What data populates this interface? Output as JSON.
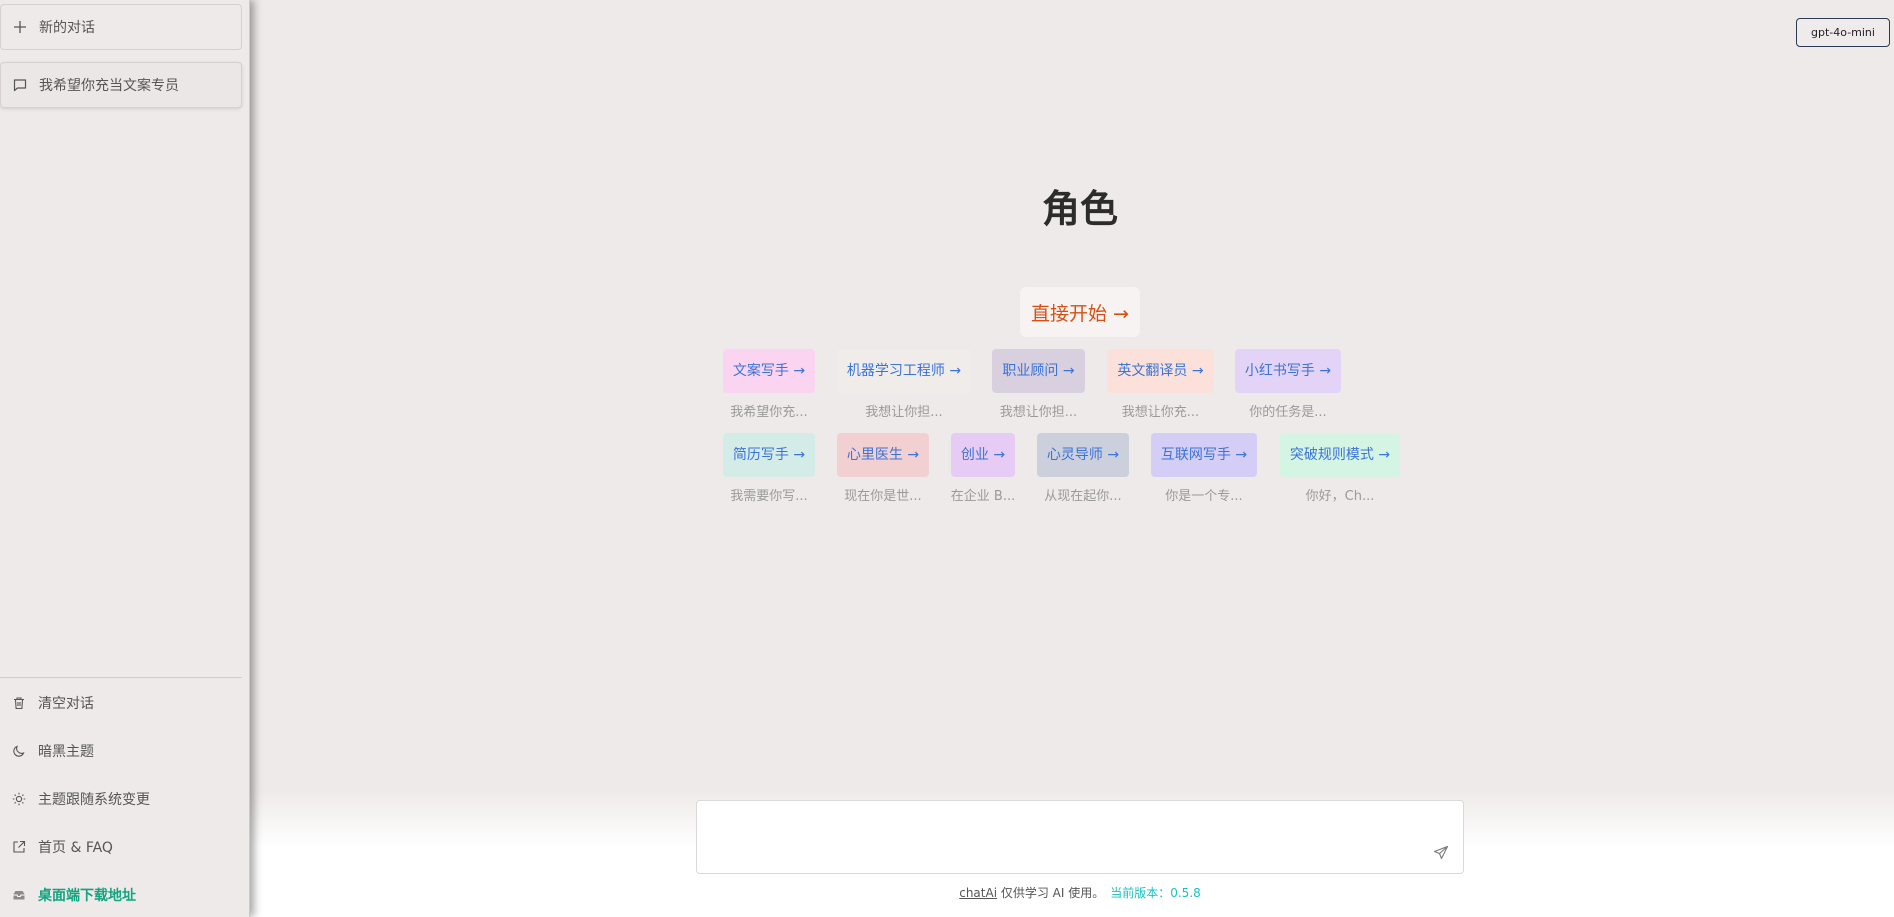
{
  "sidebar": {
    "new_chat": "新的对话",
    "conversation": "我希望你充当文案专员",
    "bottom": [
      {
        "label": "清空对话",
        "icon": "trash-icon"
      },
      {
        "label": "暗黑主题",
        "icon": "moon-icon"
      },
      {
        "label": "主题跟随系统变更",
        "icon": "sun-icon"
      },
      {
        "label": "首页 & FAQ",
        "icon": "external-link-icon"
      },
      {
        "label": "桌面端下载地址",
        "icon": "inbox-icon"
      }
    ]
  },
  "header": {
    "model": "gpt-4o-mini"
  },
  "main": {
    "title": "角色",
    "start": "直接开始 →",
    "roles": [
      {
        "label": "文案写手 →",
        "desc": "我希望你充..."
      },
      {
        "label": "机器学习工程师 →",
        "desc": "我想让你担..."
      },
      {
        "label": "职业顾问 →",
        "desc": "我想让你担..."
      },
      {
        "label": "英文翻译员 →",
        "desc": "我想让你充..."
      },
      {
        "label": "小红书写手 →",
        "desc": "你的任务是..."
      },
      {
        "label": "简历写手 →",
        "desc": "我需要你写..."
      },
      {
        "label": "心里医生 →",
        "desc": "现在你是世..."
      },
      {
        "label": "创业 →",
        "desc": "在企业 B..."
      },
      {
        "label": "心灵导师 →",
        "desc": "从现在起你..."
      },
      {
        "label": "互联网写手 →",
        "desc": "你是一个专..."
      },
      {
        "label": "突破规则模式 →",
        "desc": "你好，Ch..."
      }
    ]
  },
  "colors": {
    "role_bg": [
      "#fad4f0",
      "#f0ecea",
      "#d8d0df",
      "#fbe1d9",
      "#e3d4f7",
      "#d3ece8",
      "#f2d0d2",
      "#e6ccf4",
      "#ccd0dc",
      "#d4cdf6",
      "#d4f5e4"
    ]
  },
  "footer": {
    "link": "chatAi",
    "text": " 仅供学习 AI 使用。",
    "version": "当前版本：0.5.8"
  }
}
